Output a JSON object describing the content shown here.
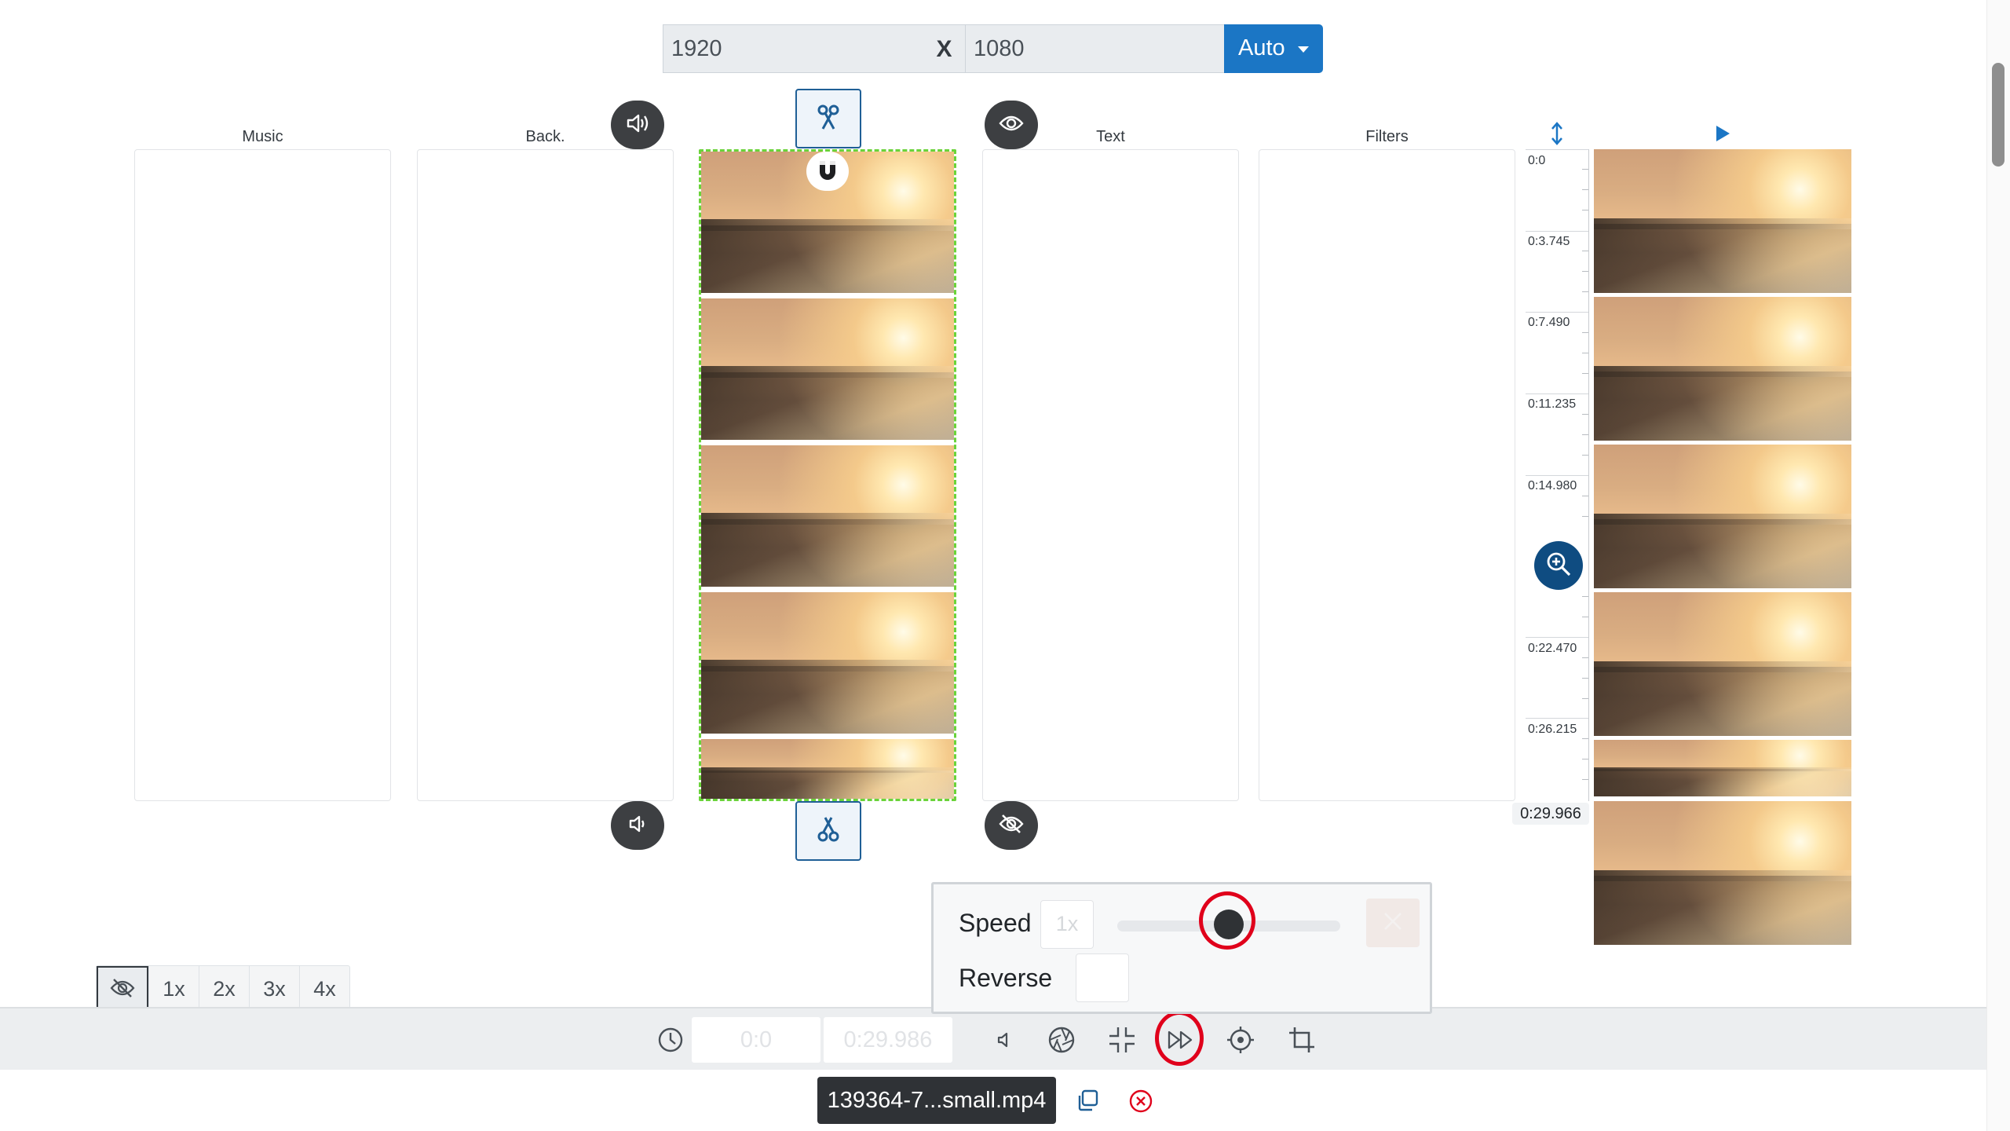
{
  "resolution": {
    "width": "1920",
    "separator": "X",
    "height": "1080",
    "mode_label": "Auto"
  },
  "tracks": {
    "music_label": "Music",
    "background_label": "Back.",
    "text_label": "Text",
    "filters_label": "Filters"
  },
  "timeline": {
    "times": [
      "0:0",
      "0:3.745",
      "0:7.490",
      "0:11.235",
      "0:14.980",
      "0:22.470",
      "0:26.215"
    ],
    "end_time": "0:29.966"
  },
  "speed_popover": {
    "speed_label": "Speed",
    "speed_value": "1x",
    "reverse_label": "Reverse",
    "slider_level": 0.5
  },
  "playback_rates": [
    "1x",
    "2x",
    "3x",
    "4x"
  ],
  "toolbar": {
    "start_time": "0:0",
    "end_time": "0:29.986"
  },
  "file": {
    "name": "139364-7...small.mp4"
  },
  "colors": {
    "accent": "#1b76c5",
    "highlight_ring": "#e0001b",
    "clip_border": "#6ad33a",
    "zoom_button": "#0f4c81"
  },
  "icons": [
    "scissors-icon",
    "speaker-icon",
    "eye-icon",
    "eye-slash-icon",
    "magnet-icon",
    "resize-vertical-icon",
    "play-icon",
    "zoom-in-icon",
    "clock-icon",
    "volume-icon",
    "aperture-icon",
    "compress-icon",
    "fast-forward-icon",
    "target-icon",
    "crop-icon",
    "copy-icon",
    "close-circle-icon"
  ]
}
